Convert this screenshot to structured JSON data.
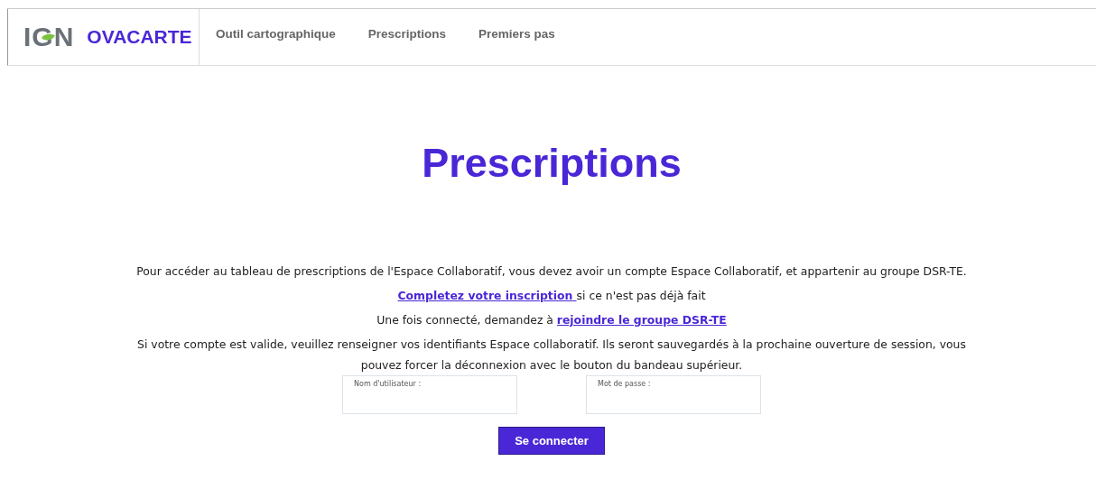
{
  "header": {
    "logo": "IGN",
    "brand": "OVACARTE",
    "nav": [
      {
        "label": "Outil cartographique",
        "selected": false
      },
      {
        "label": "Prescriptions",
        "selected": false
      },
      {
        "label": "Premiers pas",
        "selected": false
      }
    ]
  },
  "title": "Prescriptions",
  "paragraphs": [
    {
      "parts": [
        {
          "kind": "text",
          "text": "Pour accéder au tableau de prescriptions de l'Espace Collaboratif, vous devez avoir un compte Espace Collaboratif, et appartenir au groupe DSR-TE."
        }
      ]
    },
    {
      "parts": [
        {
          "kind": "link",
          "text": "Completez votre inscription "
        },
        {
          "kind": "text",
          "text": "si ce n'est pas déjà fait"
        }
      ]
    },
    {
      "parts": [
        {
          "kind": "text",
          "text": "Une fois connecté, demandez à "
        },
        {
          "kind": "link",
          "text": "rejoindre le groupe DSR-TE"
        }
      ]
    },
    {
      "parts": [
        {
          "kind": "text",
          "text": "Si votre compte est valide, veuillez renseigner vos identifiants Espace collaboratif. Ils seront sauvegardés à la prochaine ouverture de session, vous pouvez forcer la déconnexion avec le bouton du bandeau supérieur."
        }
      ]
    }
  ],
  "fields": [
    {
      "label": "Nom d'utilisateur :"
    },
    {
      "label": "Mot de passe :"
    }
  ],
  "button": "Se connecter"
}
